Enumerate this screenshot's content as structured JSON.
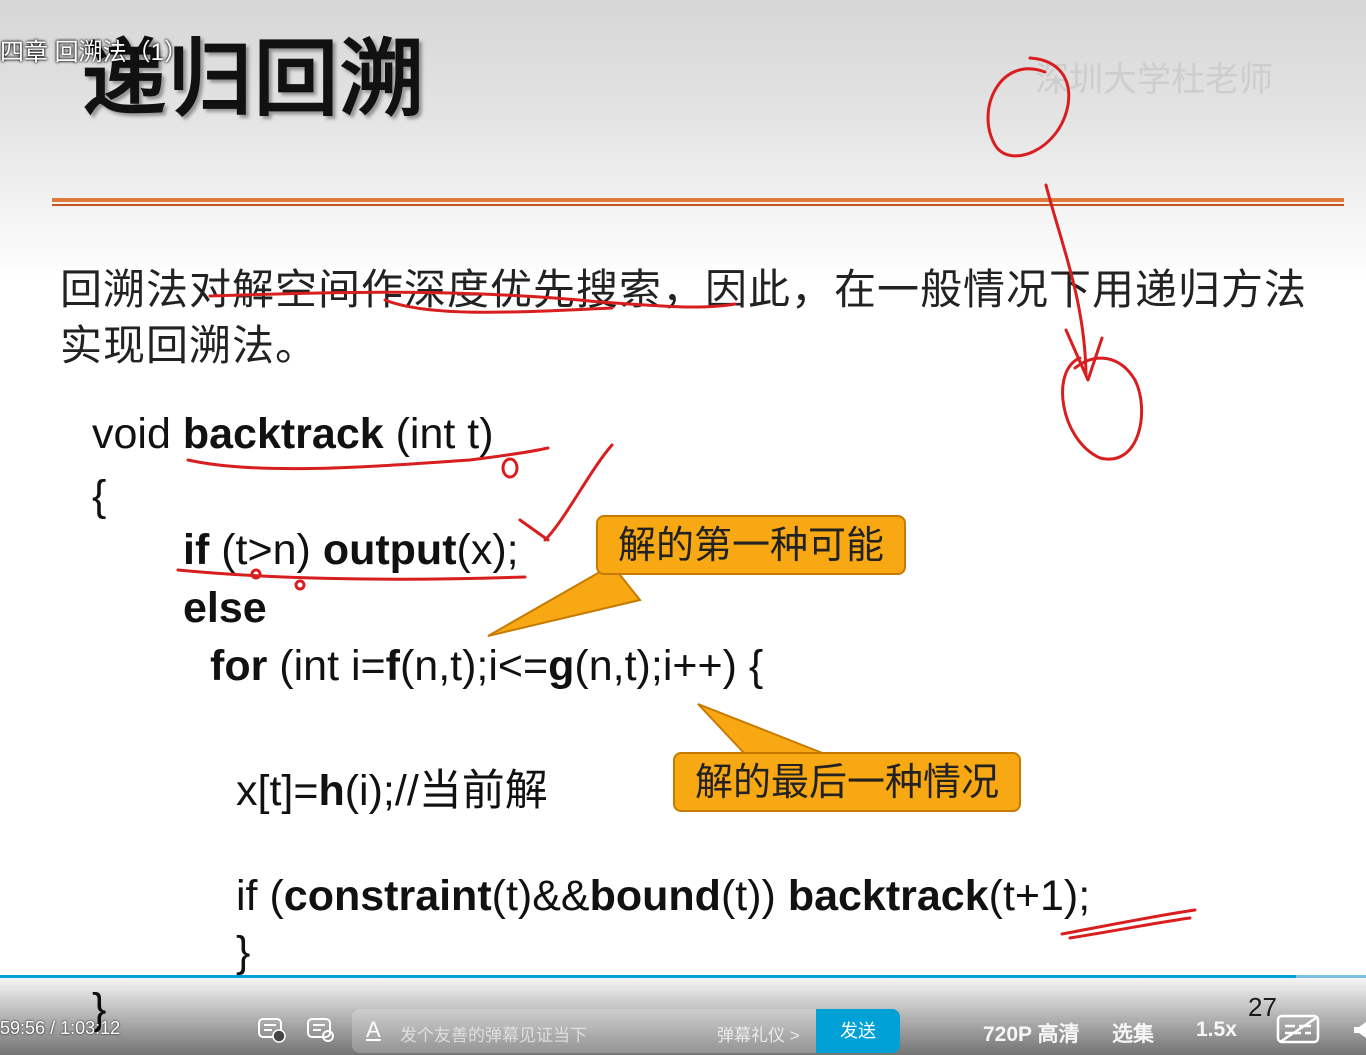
{
  "video": {
    "title": "四章 回溯法（1）"
  },
  "slide": {
    "title": "递归回溯",
    "watermark": "深圳大学杜老师",
    "intro": "回溯法对解空间作深度优先搜索，因此，在一般情况下用递归方法实现回溯法。",
    "code": {
      "signature_void": "void",
      "signature_name": "backtrack",
      "signature_args": "(int t)",
      "open_brace": "{",
      "if_kw": "if",
      "if_cond": "(t>n)",
      "output_kw": "output",
      "output_args": "(x);",
      "else_kw": "else",
      "for_kw": "for",
      "for_a": "(int i=",
      "for_f": "f",
      "for_b": "(n,t);i<=",
      "for_g": "g",
      "for_c": "(n,t);i++) {",
      "assign_a": "x[t]=",
      "assign_h": "h",
      "assign_b": "(i);//当前解",
      "if2_kw": "if (",
      "constraint": "constraint",
      "mid": "(t)&&",
      "bound": "bound",
      "mid2": "(t)) ",
      "recurse": "backtrack",
      "recurse_args": "(t+1);",
      "inner_close": "}",
      "outer_close": "}"
    },
    "callout_first": "解的第一种可能",
    "callout_last": "解的最后一种情况",
    "page_number": "27"
  },
  "player": {
    "current_time": "59:56",
    "separator": "/",
    "total_time": "1:03:12",
    "progress": 0.949,
    "danmaku_placeholder": "发个友善的弹幕见证当下",
    "danmaku_etiquette": "弹幕礼仪 >",
    "send_label": "发送",
    "quality_label": "720P 高清",
    "episodes_label": "选集",
    "speed_label": "1.5x",
    "accent": "#00a1d6"
  }
}
